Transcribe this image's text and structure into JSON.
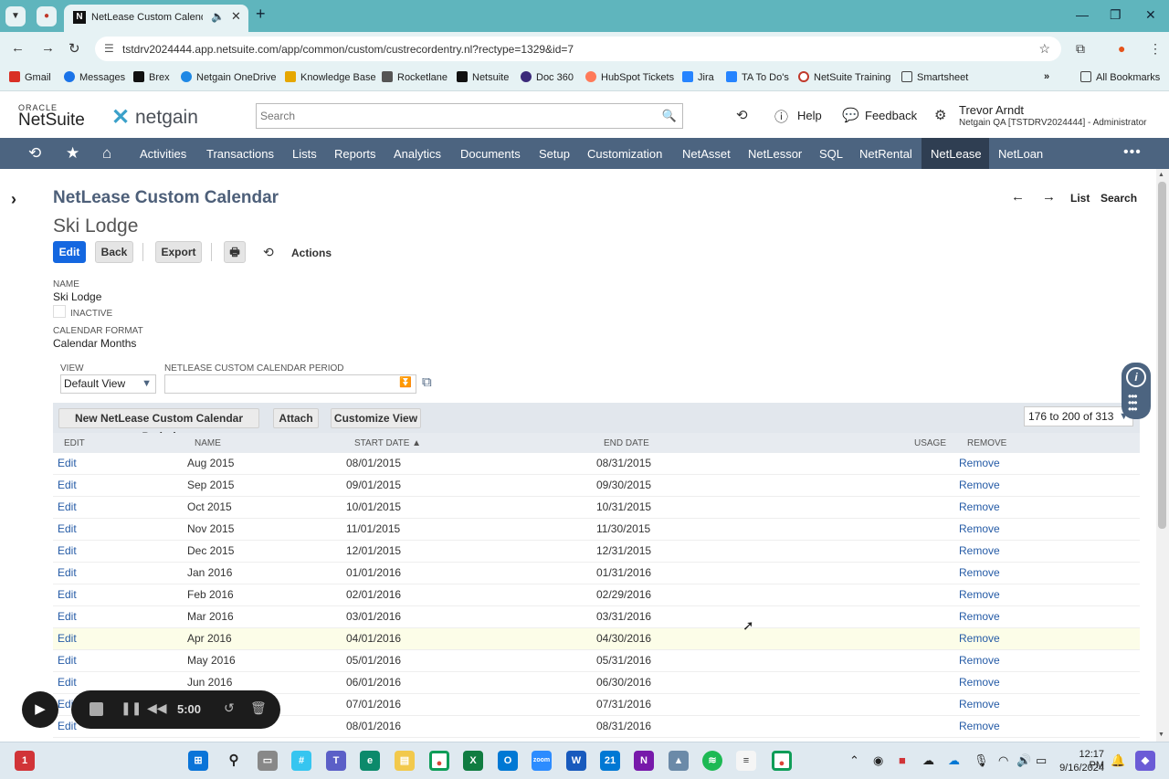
{
  "browser": {
    "tab_title": "NetLease Custom Calendar",
    "url": "tstdrv2024444.app.netsuite.com/app/common/custom/custrecordentry.nl?rectype=1329&id=7",
    "bookmarks": [
      "Gmail",
      "Messages",
      "Brex",
      "Netgain OneDrive",
      "Knowledge Base",
      "Rocketlane",
      "Netsuite",
      "Doc 360",
      "HubSpot Tickets",
      "Jira",
      "TA To Do's",
      "NetSuite Training",
      "Smartsheet"
    ],
    "all_bookmarks": "All Bookmarks"
  },
  "header": {
    "oracle": "ORACLE",
    "netsuite": "NetSuite",
    "netgain": "netgain",
    "search_placeholder": "Search",
    "help": "Help",
    "feedback": "Feedback",
    "user_name": "Trevor Arndt",
    "user_role": "Netgain QA [TSTDRV2024444] - Administrator"
  },
  "nav": {
    "items": [
      "Activities",
      "Transactions",
      "Lists",
      "Reports",
      "Analytics",
      "Documents",
      "Setup",
      "Customization",
      "NetAsset",
      "NetLessor",
      "SQL",
      "NetRental",
      "NetLease",
      "NetLoan"
    ],
    "active": "NetLease"
  },
  "record": {
    "type_title": "NetLease Custom Calendar",
    "name_title": "Ski Lodge",
    "list_link": "List",
    "search_link": "Search",
    "buttons": {
      "edit": "Edit",
      "back": "Back",
      "export": "Export",
      "actions": "Actions"
    },
    "fields": {
      "name_label": "NAME",
      "name_value": "Ski Lodge",
      "inactive_label": "INACTIVE",
      "format_label": "CALENDAR FORMAT",
      "format_value": "Calendar Months"
    }
  },
  "sublist": {
    "view_label": "VIEW",
    "view_value": "Default View",
    "period_label": "NETLEASE CUSTOM CALENDAR PERIOD",
    "period_value": "",
    "buttons": {
      "new": "New NetLease Custom Calendar Period",
      "attach": "Attach",
      "customize": "Customize View"
    },
    "pager": "176 to 200 of 313",
    "columns": {
      "edit": "EDIT",
      "name": "NAME",
      "start": "START DATE ▲",
      "end": "END DATE",
      "usage": "USAGE",
      "remove": "REMOVE"
    },
    "rows": [
      {
        "edit": "Edit",
        "name": "Aug 2015",
        "start": "08/01/2015",
        "end": "08/31/2015",
        "remove": "Remove"
      },
      {
        "edit": "Edit",
        "name": "Sep 2015",
        "start": "09/01/2015",
        "end": "09/30/2015",
        "remove": "Remove"
      },
      {
        "edit": "Edit",
        "name": "Oct 2015",
        "start": "10/01/2015",
        "end": "10/31/2015",
        "remove": "Remove"
      },
      {
        "edit": "Edit",
        "name": "Nov 2015",
        "start": "11/01/2015",
        "end": "11/30/2015",
        "remove": "Remove"
      },
      {
        "edit": "Edit",
        "name": "Dec 2015",
        "start": "12/01/2015",
        "end": "12/31/2015",
        "remove": "Remove"
      },
      {
        "edit": "Edit",
        "name": "Jan 2016",
        "start": "01/01/2016",
        "end": "01/31/2016",
        "remove": "Remove"
      },
      {
        "edit": "Edit",
        "name": "Feb 2016",
        "start": "02/01/2016",
        "end": "02/29/2016",
        "remove": "Remove"
      },
      {
        "edit": "Edit",
        "name": "Mar 2016",
        "start": "03/01/2016",
        "end": "03/31/2016",
        "remove": "Remove"
      },
      {
        "edit": "Edit",
        "name": "Apr 2016",
        "start": "04/01/2016",
        "end": "04/30/2016",
        "remove": "Remove",
        "highlight": true
      },
      {
        "edit": "Edit",
        "name": "May 2016",
        "start": "05/01/2016",
        "end": "05/31/2016",
        "remove": "Remove"
      },
      {
        "edit": "Edit",
        "name": "Jun 2016",
        "start": "06/01/2016",
        "end": "06/30/2016",
        "remove": "Remove"
      },
      {
        "edit": "Edit",
        "name": "",
        "start": "07/01/2016",
        "end": "07/31/2016",
        "remove": "Remove"
      },
      {
        "edit": "Edit",
        "name": "",
        "start": "08/01/2016",
        "end": "08/31/2016",
        "remove": "Remove"
      }
    ]
  },
  "recorder": {
    "time": "5:00"
  },
  "taskbar": {
    "time": "12:17 PM",
    "date": "9/16/2024",
    "badge_teams": "21",
    "badge_start": "1"
  },
  "colors": {
    "nav_bg": "#4c6480",
    "nav_active": "#2f3e52",
    "primary_button": "#1467e0",
    "link": "#255ba6",
    "title": "#4d5f79",
    "tabbar": "#5fb5bd"
  }
}
